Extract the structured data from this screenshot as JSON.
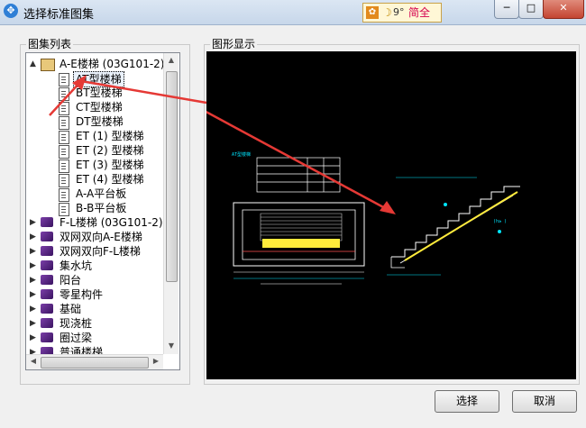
{
  "window": {
    "title": "选择标准图集",
    "controls": {
      "minimize": "─",
      "maximize": "□",
      "close": "✕"
    }
  },
  "ime": {
    "mode": "9°",
    "label": "简全"
  },
  "left_panel": {
    "title": "图集列表",
    "tree": [
      {
        "label": "A-E楼梯 (03G101-2)",
        "level": 0,
        "icon": "open-book-icon",
        "expander": "▲"
      },
      {
        "label": "AT型楼梯",
        "level": 1,
        "icon": "document-icon",
        "selected": true
      },
      {
        "label": "BT型楼梯",
        "level": 1,
        "icon": "document-icon"
      },
      {
        "label": "CT型楼梯",
        "level": 1,
        "icon": "document-icon"
      },
      {
        "label": "DT型楼梯",
        "level": 1,
        "icon": "document-icon"
      },
      {
        "label": "ET (1) 型楼梯",
        "level": 1,
        "icon": "document-icon"
      },
      {
        "label": "ET (2) 型楼梯",
        "level": 1,
        "icon": "document-icon"
      },
      {
        "label": "ET (3) 型楼梯",
        "level": 1,
        "icon": "document-icon"
      },
      {
        "label": "ET (4) 型楼梯",
        "level": 1,
        "icon": "document-icon"
      },
      {
        "label": "A-A平台板",
        "level": 1,
        "icon": "document-icon"
      },
      {
        "label": "B-B平台板",
        "level": 1,
        "icon": "document-icon"
      },
      {
        "label": "F-L楼梯 (03G101-2)",
        "level": 0,
        "icon": "book-icon",
        "expander": "▶"
      },
      {
        "label": "双网双向A-E楼梯",
        "level": 0,
        "icon": "book-icon",
        "expander": "▶"
      },
      {
        "label": "双网双向F-L楼梯",
        "level": 0,
        "icon": "book-icon",
        "expander": "▶"
      },
      {
        "label": "集水坑",
        "level": 0,
        "icon": "book-icon",
        "expander": "▶"
      },
      {
        "label": "阳台",
        "level": 0,
        "icon": "book-icon",
        "expander": "▶"
      },
      {
        "label": "零星构件",
        "level": 0,
        "icon": "book-icon",
        "expander": "▶"
      },
      {
        "label": "基础",
        "level": 0,
        "icon": "book-icon",
        "expander": "▶"
      },
      {
        "label": "现浇桩",
        "level": 0,
        "icon": "book-icon",
        "expander": "▶"
      },
      {
        "label": "圈过梁",
        "level": 0,
        "icon": "book-icon",
        "expander": "▶"
      },
      {
        "label": "普通楼梯",
        "level": 0,
        "icon": "book-icon",
        "expander": "▶"
      }
    ],
    "scroll_arrows": {
      "up": "▲",
      "down": "▼",
      "left": "◀",
      "right": "▶"
    }
  },
  "right_panel": {
    "title": "图形显示",
    "preview": {
      "background": "#000000",
      "labels": {
        "plan_title": "AT型楼梯",
        "section_title": "(h≥ )"
      }
    }
  },
  "buttons": {
    "select": "选择",
    "cancel": "取消"
  },
  "annotation": {
    "arrow_color": "#e53935"
  }
}
